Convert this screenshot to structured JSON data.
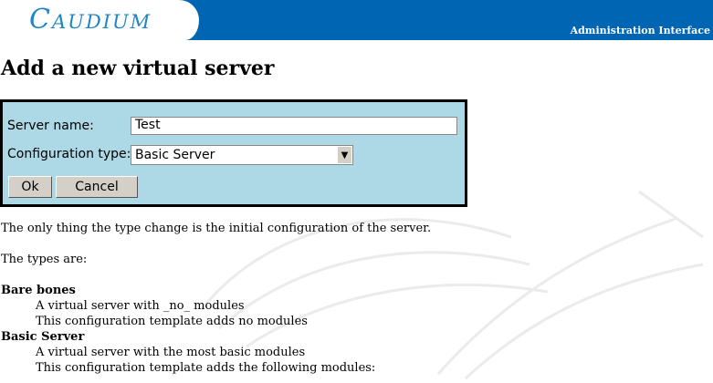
{
  "header": {
    "logo_text": "Caudium",
    "admin_label": "Administration Interface",
    "bg_color": "#0066b3"
  },
  "page": {
    "title": "Add a new virtual server"
  },
  "form": {
    "bg_color": "#add8e6",
    "server_name_label": "Server name:",
    "server_name_value": "Test",
    "config_type_label": "Configuration type:",
    "config_type_value": "Basic Server",
    "ok_label": "Ok",
    "cancel_label": "Cancel"
  },
  "content": {
    "intro": "The only thing the type change is the initial configuration of the server.",
    "types_heading": "The types are:",
    "types": [
      {
        "name": "Bare bones",
        "lines": [
          "A virtual server with _no_ modules",
          "This configuration template adds no modules"
        ]
      },
      {
        "name": "Basic Server",
        "lines": [
          "A virtual server with the most basic modules",
          "This configuration template adds the following modules:"
        ]
      }
    ]
  }
}
